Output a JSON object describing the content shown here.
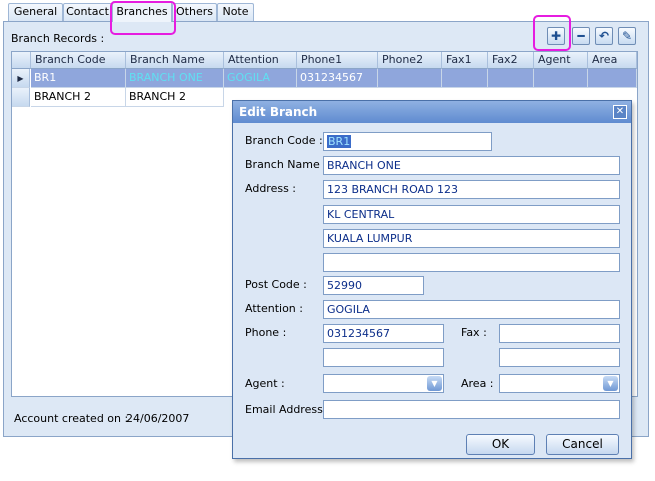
{
  "tabs": [
    "General",
    "Contact",
    "Branches",
    "Others",
    "Note"
  ],
  "active_tab": "Branches",
  "records_label": "Branch Records :",
  "toolbar": {
    "add_icon": "plus-icon",
    "remove_icon": "minus-icon",
    "undo_icon": "undo-icon",
    "edit_icon": "edit-icon"
  },
  "grid": {
    "columns": [
      "Branch Code",
      "Branch Name",
      "Attention",
      "Phone1",
      "Phone2",
      "Fax1",
      "Fax2",
      "Agent",
      "Area"
    ],
    "rows": [
      [
        "BR1",
        "BRANCH ONE",
        "GOGILA",
        "031234567",
        "",
        "",
        "",
        "",
        ""
      ],
      [
        "BRANCH 2",
        "BRANCH 2",
        "",
        "",
        "",
        "",
        "",
        "",
        ""
      ]
    ],
    "row_indicator": "▶"
  },
  "footer": {
    "label": "Account created on :",
    "date": "24/06/2007"
  },
  "dialog": {
    "title": "Edit Branch",
    "close": "✕",
    "labels": {
      "branch_code": "Branch Code :",
      "branch_name": "Branch Name :",
      "address": "Address :",
      "post_code": "Post Code :",
      "attention": "Attention :",
      "phone": "Phone :",
      "fax": "Fax :",
      "agent": "Agent :",
      "area": "Area :",
      "email": "Email Address"
    },
    "values": {
      "branch_code": "BR1",
      "branch_name": "BRANCH ONE",
      "address1": "123 BRANCH ROAD 123",
      "address2": "KL CENTRAL",
      "address3": "KUALA LUMPUR",
      "address4": "",
      "post_code": "52990",
      "attention": "GOGILA",
      "phone1": "031234567",
      "phone2": "",
      "fax1": "",
      "fax2": "",
      "agent": "",
      "area": "",
      "email": ""
    },
    "ok_label": "OK",
    "cancel_label": "Cancel"
  },
  "colors": {
    "highlight": "#e61ce0",
    "selected_row": "#8fa6dc",
    "dialog_title": "#5f8bd0"
  }
}
